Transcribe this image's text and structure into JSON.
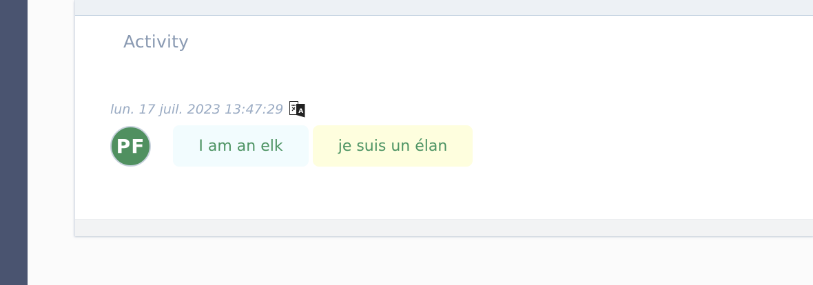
{
  "activity": {
    "title": "Activity",
    "entries": [
      {
        "timestamp": "lun. 17 juil. 2023 13:47:29",
        "translate_icon": "translate-icon",
        "avatar_initials": "PF",
        "source_text": "I am an elk",
        "translated_text": "je suis un élan"
      }
    ]
  },
  "colors": {
    "sidebar": "#4a5470",
    "avatar": "#509060",
    "source_bubble": "#f2fcfe",
    "translation_bubble": "#fefede",
    "text_accent": "#4e9464",
    "muted_text": "#8a9ab2"
  }
}
